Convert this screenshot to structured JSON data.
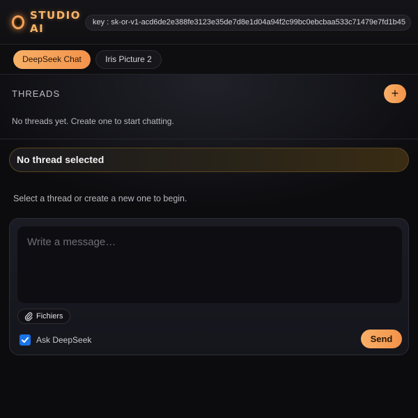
{
  "header": {
    "brand": "STUDIO AI",
    "logo_icon": "ring-logo-icon",
    "api_key": "key : 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"
  },
  "tabs": [
    {
      "label": "DeepSeek Chat",
      "active": true
    },
    {
      "label": "Iris Picture 2",
      "active": false
    }
  ],
  "threads": {
    "title": "THREADS",
    "add_label": "+",
    "empty_text": "No threads yet. Create one to start chatting."
  },
  "thread_view": {
    "title": "No thread selected",
    "hint": "Select a thread or create a new one to begin."
  },
  "composer": {
    "placeholder": "Write a message…",
    "value": "",
    "files_label": "Fichiers",
    "files_icon": "paperclip-icon",
    "ask_label": "Ask DeepSeek",
    "ask_checked": true,
    "send_label": "Send"
  },
  "colors": {
    "accent": "#f5a25a",
    "background": "#0c0c0f",
    "checkbox": "#1a73e8"
  }
}
